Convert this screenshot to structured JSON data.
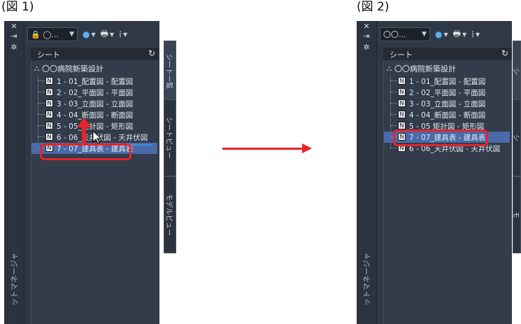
{
  "figure_labels": [
    "(図 1)",
    "(図 2)"
  ],
  "panels": [
    {
      "combo_text": "🔒 ◯...",
      "header_title": "シート",
      "root_label": "〇〇病院新築設計",
      "rows": [
        "1 - 01_配置図 - 配置図",
        "2 - 02_平面図 - 平面図",
        "3 - 03_立面図 - 立面図",
        "4 - 04_断面図 - 断面図",
        "5 - 05_矩計図 - 矩形図",
        "6 - 06_天井伏図 - 天井伏図",
        "7 - 07_建具表 - 建具表"
      ],
      "left_vertical": "ットマネージャ",
      "right_tabs": [
        "シート一覧",
        "シートビュー",
        "モデルビュー"
      ]
    },
    {
      "combo_text": "〇〇...",
      "header_title": "シート",
      "root_label": "〇〇病院新築設計",
      "rows": [
        "1 - 01_配置図 - 配置図",
        "2 - 02_平面図 - 平面図",
        "3 - 03_立面図 - 立面図",
        "4 - 04_断面図 - 断面図",
        "5 - 05 矩計図 - 矩形図",
        "7 - 07_建具表 - 建具表",
        "6 - 06_天井伏図 - 天井伏図"
      ],
      "left_vertical": "ットマネージャ",
      "right_tabs": [
        "シ",
        "シ",
        "モ"
      ]
    }
  ],
  "colors": {
    "panel_bg": "#2f3845",
    "highlight": "#e8232b",
    "selection": "#4a6aa8"
  }
}
